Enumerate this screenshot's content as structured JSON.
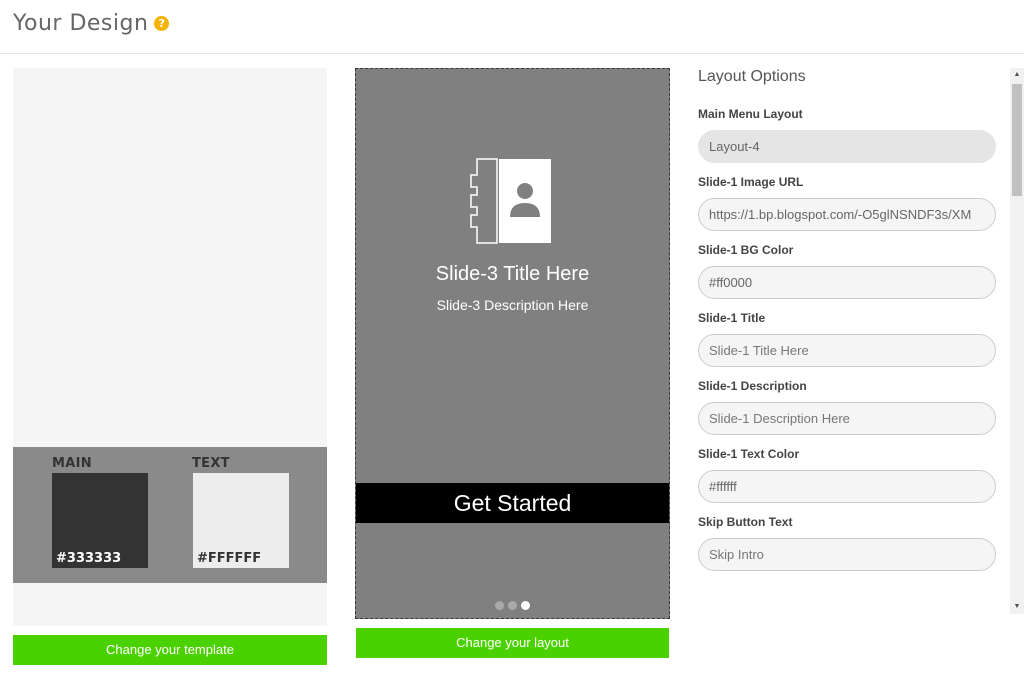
{
  "header": {
    "title": "Your Design",
    "help_icon": "?"
  },
  "template": {
    "main_label": "MAIN",
    "main_hex": "#333333",
    "text_label": "TEXT",
    "text_hex": "#FFFFFF",
    "button_label": "Change your template"
  },
  "preview": {
    "slide_title": "Slide-3 Title Here",
    "slide_description": "Slide-3 Description Here",
    "cta_label": "Get Started",
    "dots_total": 3,
    "active_dot": 3,
    "button_label": "Change your layout"
  },
  "options": {
    "title": "Layout Options",
    "fields": [
      {
        "label": "Main Menu Layout",
        "value": "Layout-4",
        "placeholder": "",
        "disabled": true
      },
      {
        "label": "Slide-1 Image URL",
        "value": "https://1.bp.blogspot.com/-O5glNSNDF3s/XM",
        "placeholder": ""
      },
      {
        "label": "Slide-1 BG Color",
        "value": "#ff0000",
        "placeholder": ""
      },
      {
        "label": "Slide-1 Title",
        "value": "",
        "placeholder": "Slide-1 Title Here"
      },
      {
        "label": "Slide-1 Description",
        "value": "",
        "placeholder": "Slide-1 Description Here"
      },
      {
        "label": "Slide-1 Text Color",
        "value": "#ffffff",
        "placeholder": ""
      },
      {
        "label": "Skip Button Text",
        "value": "",
        "placeholder": "Skip Intro"
      }
    ]
  },
  "colors": {
    "accent_green": "#4cd100",
    "preview_bg": "#808080",
    "help_yellow": "#f5b301"
  }
}
